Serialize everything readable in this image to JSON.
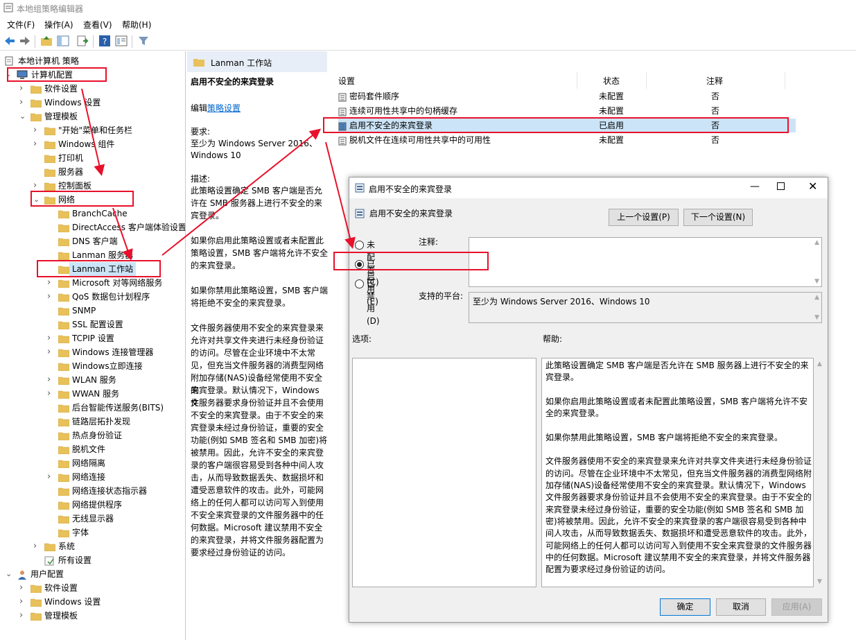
{
  "window": {
    "title": "本地组策略编辑器"
  },
  "menu": [
    "文件(F)",
    "操作(A)",
    "查看(V)",
    "帮助(H)"
  ],
  "tree": {
    "root": "本地计算机 策略",
    "computer_config": "计算机配置",
    "items": [
      {
        "label": "软件设置"
      },
      {
        "label": "Windows 设置"
      },
      {
        "label": "管理模板"
      },
      {
        "label": "\"开始\"菜单和任务栏"
      },
      {
        "label": "Windows 组件"
      },
      {
        "label": "打印机"
      },
      {
        "label": "服务器"
      },
      {
        "label": "控制面板"
      },
      {
        "label": "网络"
      },
      {
        "label": "BranchCache"
      },
      {
        "label": "DirectAccess 客户端体验设置"
      },
      {
        "label": "DNS 客户端"
      },
      {
        "label": "Lanman 服务器"
      },
      {
        "label": "Lanman 工作站"
      },
      {
        "label": "Microsoft 对等网络服务"
      },
      {
        "label": "QoS 数据包计划程序"
      },
      {
        "label": "SNMP"
      },
      {
        "label": "SSL 配置设置"
      },
      {
        "label": "TCPIP 设置"
      },
      {
        "label": "Windows 连接管理器"
      },
      {
        "label": "Windows立即连接"
      },
      {
        "label": "WLAN 服务"
      },
      {
        "label": "WWAN 服务"
      },
      {
        "label": "后台智能传送服务(BITS)"
      },
      {
        "label": "链路层拓扑发现"
      },
      {
        "label": "热点身份验证"
      },
      {
        "label": "脱机文件"
      },
      {
        "label": "网络隔离"
      },
      {
        "label": "网络连接"
      },
      {
        "label": "网络连接状态指示器"
      },
      {
        "label": "网络提供程序"
      },
      {
        "label": "无线显示器"
      },
      {
        "label": "字体"
      },
      {
        "label": "系统"
      },
      {
        "label": "所有设置"
      },
      {
        "label": "用户配置"
      },
      {
        "label": "软件设置"
      },
      {
        "label": "Windows 设置"
      },
      {
        "label": "管理模板"
      }
    ]
  },
  "middle": {
    "header": "Lanman 工作站",
    "title": "启用不安全的来宾登录",
    "edit_prefix": "编辑",
    "edit_link": "策略设置",
    "req_label": "要求:",
    "req_lines": [
      "至少为 Windows Server 2016、",
      "Windows 10"
    ],
    "desc_label": "描述:",
    "desc_lines": [
      "此策略设置确定 SMB 客户端是否允",
      "许在 SMB 服务器上进行不安全的来",
      "宾登录。",
      "",
      "如果你启用此策略设置或者未配置此",
      "策略设置，SMB 客户端将允许不安全",
      "的来宾登录。",
      "",
      "如果你禁用此策略设置，SMB 客户端",
      "将拒绝不安全的来宾登录。",
      "",
      "文件服务器使用不安全的来宾登录来",
      "允许对共享文件夹进行未经身份验证",
      "的访问。尽管在企业环境中不太常",
      "见，但充当文件服务器的消费型网络",
      "附加存储(NAS)设备经常使用不安全的",
      "来宾登录。默认情况下，Windows 文",
      "件服务器要求身份验证并且不会使用",
      "不安全的来宾登录。由于不安全的来",
      "宾登录未经过身份验证，重要的安全",
      "功能(例如 SMB 签名和 SMB 加密)将",
      "被禁用。因此，允许不安全的来宾登",
      "录的客户端很容易受到各种中间人攻",
      "击，从而导致数据丢失、数据损坏和",
      "遭受恶意软件的攻击。此外，可能网",
      "络上的任何人都可以访问写入到使用",
      "不安全来宾登录的文件服务器中的任",
      "何数据。Microsoft 建议禁用不安全",
      "的来宾登录，并将文件服务器配置为",
      "要求经过身份验证的访问。"
    ]
  },
  "list": {
    "headers": {
      "setting": "设置",
      "state": "状态",
      "comment": "注释"
    },
    "rows": [
      {
        "name": "密码套件顺序",
        "state": "未配置",
        "comment": "否"
      },
      {
        "name": "连续可用性共享中的句柄缓存",
        "state": "未配置",
        "comment": "否"
      },
      {
        "name": "启用不安全的来宾登录",
        "state": "已启用",
        "comment": "否"
      },
      {
        "name": "脱机文件在连续可用性共享中的可用性",
        "state": "未配置",
        "comment": "否"
      }
    ]
  },
  "dialog": {
    "title": "启用不安全的来宾登录",
    "setting_name": "启用不安全的来宾登录",
    "prev_button": "上一个设置(P)",
    "next_button": "下一个设置(N)",
    "radio_not_configured": "未配置(C)",
    "radio_enabled": "已启用(E)",
    "radio_disabled": "已禁用(D)",
    "selected": "enabled",
    "comment_label": "注释:",
    "platform_label": "支持的平台:",
    "platform_value": "至少为 Windows Server 2016、Windows 10",
    "options_label": "选项:",
    "help_label": "帮助:",
    "help_lines": [
      "此策略设置确定 SMB 客户端是否允许在 SMB 服务器上进行不安全的来",
      "宾登录。",
      "",
      "如果你启用此策略设置或者未配置此策略设置，SMB 客户端将允许不安",
      "全的来宾登录。",
      "",
      "如果你禁用此策略设置，SMB 客户端将拒绝不安全的来宾登录。",
      "",
      "文件服务器使用不安全的来宾登录来允许对共享文件夹进行未经身份验证",
      "的访问。尽管在企业环境中不太常见，但充当文件服务器的消费型网络附",
      "加存储(NAS)设备经常使用不安全的来宾登录。默认情况下，Windows",
      "文件服务器要求身份验证并且不会使用不安全的来宾登录。由于不安全的",
      "来宾登录未经过身份验证，重要的安全功能(例如 SMB 签名和 SMB 加",
      "密)将被禁用。因此，允许不安全的来宾登录的客户端很容易受到各种中",
      "间人攻击，从而导致数据丢失、数据损坏和遭受恶意软件的攻击。此外，",
      "可能网络上的任何人都可以访问写入到使用不安全来宾登录的文件服务器",
      "中的任何数据。Microsoft 建议禁用不安全的来宾登录，并将文件服务器",
      "配置为要求经过身份验证的访问。"
    ],
    "ok_button": "确定",
    "cancel_button": "取消",
    "apply_button": "应用(A)"
  },
  "colors": {
    "annotation": "#e8102a",
    "folder": "#e8c15a",
    "link": "#0066cc",
    "selected_row": "#cce4f7"
  }
}
